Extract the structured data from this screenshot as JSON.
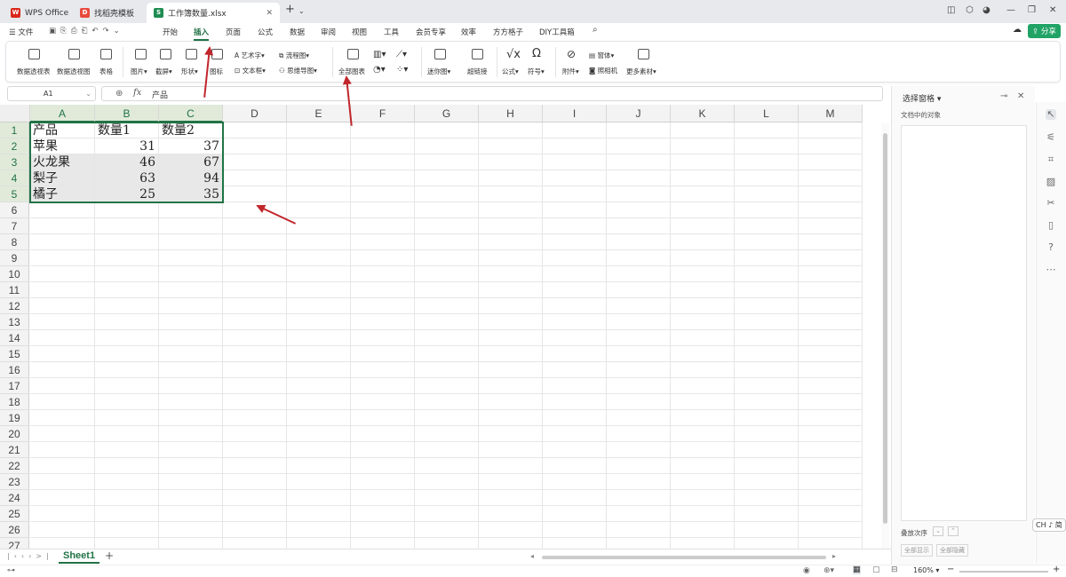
{
  "tabs": [
    {
      "label": "WPS Office",
      "icon": "wps-logo-icon",
      "color": "#d9281a"
    },
    {
      "label": "找稻壳模板",
      "icon": "docer-icon",
      "color": "#e84a3c"
    },
    {
      "label": "工作簿数量.xlsx",
      "icon": "spreadsheet-icon",
      "color": "#1e8c52"
    }
  ],
  "menu": {
    "file": "文件",
    "items": [
      "开始",
      "插入",
      "页面",
      "公式",
      "数据",
      "审阅",
      "视图",
      "工具",
      "会员专享",
      "效率",
      "方方格子",
      "DIY工具箱"
    ],
    "active": "插入",
    "share": "分享"
  },
  "ribbon": {
    "pivot_table": "数据透视表",
    "pivot_chart": "数据透视图",
    "table": "表格",
    "picture": "图片",
    "screenshot": "截屏",
    "shape": "形状",
    "icon": "图标",
    "art_text": "艺术字",
    "text_box": "文本框",
    "flowchart": "流程图",
    "mindmap": "思维导图",
    "all_charts": "全部图表",
    "sparkline": "迷你图",
    "hyperlink": "超链接",
    "formula": "公式",
    "symbol": "符号",
    "attachment": "附件",
    "object": "窗体",
    "camera": "照相机",
    "more": "更多素材"
  },
  "formula_bar": {
    "cell_ref": "A1",
    "content": "产品"
  },
  "columns": [
    "A",
    "B",
    "C",
    "D",
    "E",
    "F",
    "G",
    "H",
    "I",
    "J",
    "K",
    "L",
    "M"
  ],
  "rows": [
    "1",
    "2",
    "3",
    "4",
    "5",
    "6",
    "7",
    "8",
    "9",
    "10",
    "11",
    "12",
    "13",
    "14",
    "15",
    "16",
    "17",
    "18",
    "19",
    "20",
    "21",
    "22",
    "23",
    "24",
    "25",
    "26",
    "27"
  ],
  "table": {
    "headers": [
      "产品",
      "数量1",
      "数量2"
    ],
    "data": [
      [
        "苹果",
        "31",
        "37"
      ],
      [
        "火龙果",
        "46",
        "67"
      ],
      [
        "梨子",
        "63",
        "94"
      ],
      [
        "橘子",
        "25",
        "35"
      ]
    ]
  },
  "side_pane": {
    "title": "选择窗格",
    "subtitle": "文档中的对象",
    "order_label": "叠放次序",
    "show_all": "全部显示",
    "hide_all": "全部隐藏"
  },
  "sheet_tab": "Sheet1",
  "status": {
    "zoom": "160%",
    "ime": "CH ♪ 简"
  },
  "colors": {
    "accent": "#217346",
    "wps_red": "#d9281a",
    "arrow": "#c0262b",
    "share_btn": "#21a366"
  }
}
